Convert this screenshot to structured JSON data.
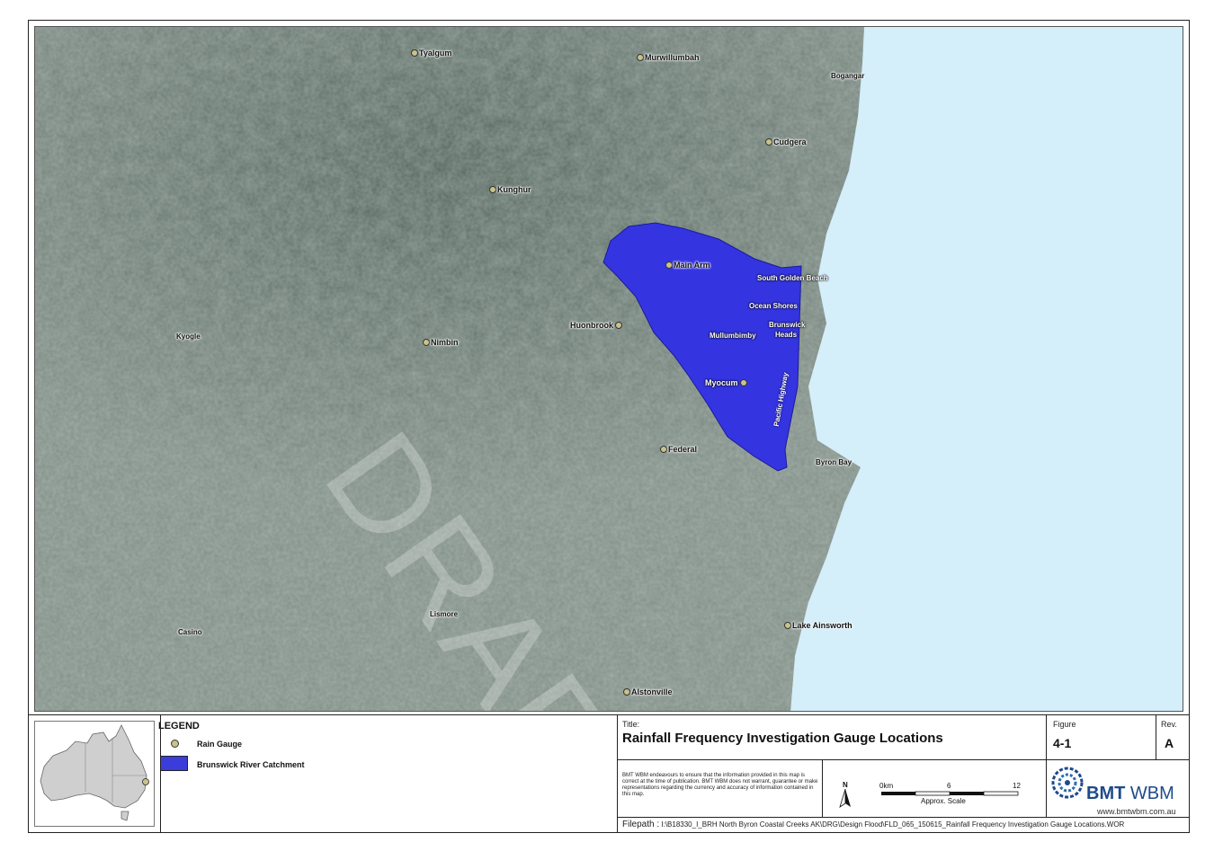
{
  "watermark": "DRAFT",
  "places": [
    {
      "name": "Tyalgum",
      "dot": true
    },
    {
      "name": "Murwillumbah",
      "dot": true
    },
    {
      "name": "Bogangar",
      "dot": false
    },
    {
      "name": "Cudgera",
      "dot": true
    },
    {
      "name": "Kunghur",
      "dot": true
    },
    {
      "name": "Main Arm",
      "dot": true
    },
    {
      "name": "South Golden Beach",
      "dot": false
    },
    {
      "name": "Ocean Shores",
      "dot": false
    },
    {
      "name": "Brunswick",
      "dot": false
    },
    {
      "name": "Heads",
      "dot": false
    },
    {
      "name": "Mullumbimby",
      "dot": false
    },
    {
      "name": "Huonbrook",
      "dot": true
    },
    {
      "name": "Nimbin",
      "dot": true
    },
    {
      "name": "Kyogle",
      "dot": false
    },
    {
      "name": "Myocum",
      "dot": true
    },
    {
      "name": "Federal",
      "dot": true
    },
    {
      "name": "Byron Bay",
      "dot": false
    },
    {
      "name": "Lismore",
      "dot": false
    },
    {
      "name": "Casino",
      "dot": false
    },
    {
      "name": "Lake Ainsworth",
      "dot": true
    },
    {
      "name": "Alstonville",
      "dot": true
    }
  ],
  "road_label": "Pacific Highway",
  "legend": {
    "title": "LEGEND",
    "items": [
      "Rain Gauge",
      "Brunswick River Catchment"
    ]
  },
  "title_block": {
    "title_label": "Title:",
    "title": "Rainfall Frequency Investigation Gauge Locations",
    "figure_label": "Figure",
    "figure": "4-1",
    "rev_label": "Rev.",
    "rev": "A",
    "disclaimer": "BMT WBM endeavours to ensure that the information provided in this map is correct at the time of publication. BMT WBM does not warrant, guarantee or make representations regarding the currency and accuracy of information contained in this map.",
    "north": "N",
    "scale_ticks": [
      "0km",
      "6",
      "12"
    ],
    "scale_label": "Approx. Scale",
    "filepath_label": "Filepath :",
    "filepath": "I:\\B18330_I_BRH North Byron Coastal Creeks AK\\DRG\\Design Flood\\FLD_065_150615_Rainfall Frequency Investigation Gauge Locations.WOR",
    "logo_a": "BMT",
    "logo_b": "WBM",
    "logo_url": "www.bmtwbm.com.au"
  },
  "colors": {
    "ocean": "#d4eefa",
    "land": "#6e7f73",
    "catchment": "#3434e0"
  }
}
